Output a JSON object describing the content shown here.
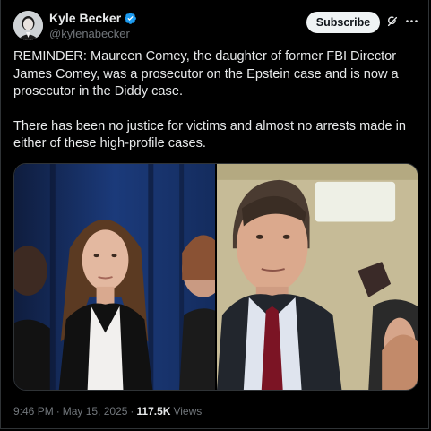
{
  "author": {
    "name": "Kyle Becker",
    "handle": "@kylenabecker",
    "verified": true
  },
  "actions": {
    "subscribe_label": "Subscribe",
    "grok_icon": "grok-icon",
    "more_icon": "more-icon"
  },
  "tweet": {
    "paragraphs": [
      "REMINDER: Maureen Comey, the daughter of former FBI Director James Comey, was a prosecutor on the Epstein case and is now a prosecutor in the Diddy case.",
      "There has been no justice for victims and almost no arrests made in either of these high-profile cases."
    ]
  },
  "media": {
    "photos": [
      {
        "alt_icon": "photo-woman"
      },
      {
        "alt_icon": "photo-man"
      }
    ]
  },
  "meta": {
    "time": "9:46 PM",
    "separator": "·",
    "date": "May 15, 2025",
    "separator2": "·",
    "views_count": "117.5K",
    "views_label": "Views"
  },
  "colors": {
    "background": "#000000",
    "text": "#e7e9ea",
    "secondary": "#71767b",
    "verified": "#1d9bf0"
  }
}
